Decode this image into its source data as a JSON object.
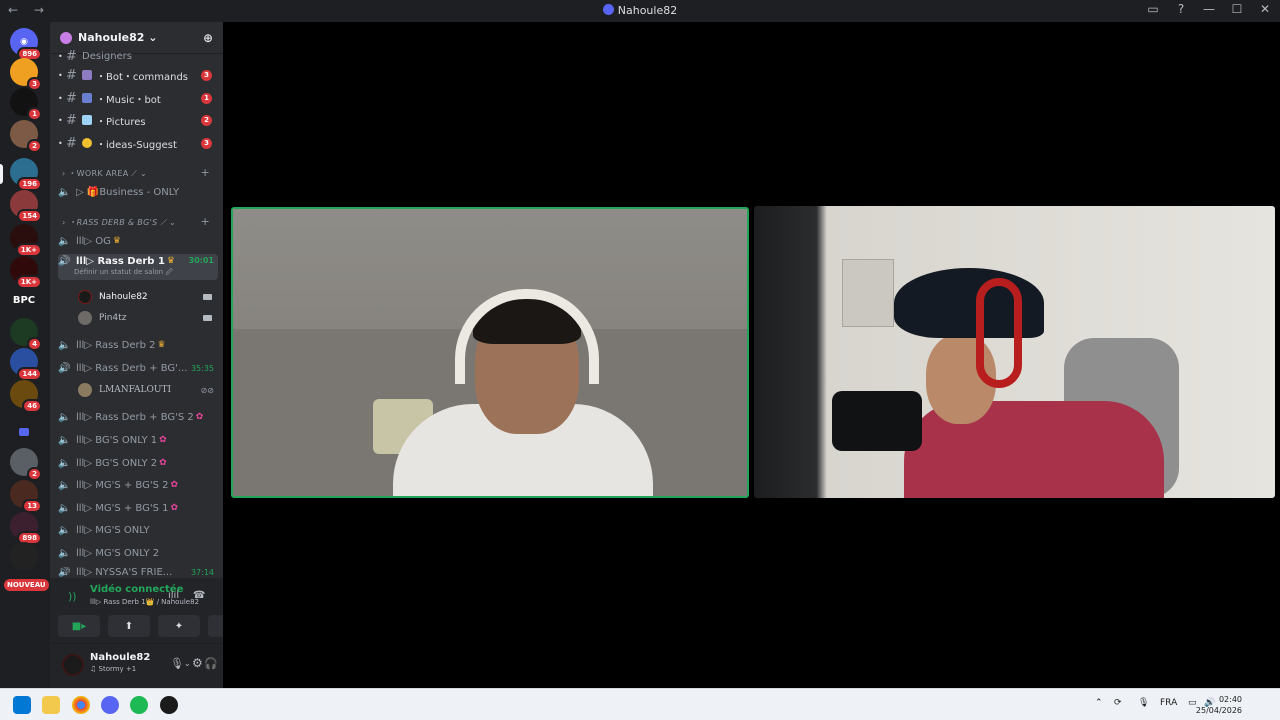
{
  "window": {
    "title": "Nahoule82",
    "nav": "← →",
    "controls": [
      "▭",
      "?",
      "—",
      "☐",
      "✕"
    ]
  },
  "guild": {
    "name": "Nahoule82 ⌄",
    "add_icon": "add-member-icon"
  },
  "servers": {
    "badges": [
      "896",
      "3",
      "1",
      "2",
      "196",
      "154",
      "1K+",
      "1K+",
      "4",
      "144",
      "46",
      "2",
      "13",
      "898"
    ],
    "bpc_label": "BPC",
    "nouveau_label": "NOUVEAU"
  },
  "text_channels": [
    {
      "name": "Designers",
      "count": ""
    },
    {
      "name": "・Bot・commands",
      "count": "3"
    },
    {
      "name": "・Music・bot",
      "count": "1"
    },
    {
      "name": "・Pictures",
      "count": "2"
    },
    {
      "name": "・ideas-Suggest",
      "count": "3"
    }
  ],
  "categories": {
    "work_area": "WORK AREA ⟋ ⌄",
    "rass_derb": "RASS DERB & BG'S ⟋ ⌄"
  },
  "voice_channels": {
    "business": "▷ 🎁Business - ONLY",
    "og": "lll▷ OG",
    "rass1": "lll▷ Rass Derb 1",
    "rass1_timer": "30:01",
    "rass1_status": "Définir un statut de salon 🖉",
    "rass2": "lll▷ Rass Derb 2",
    "rass_bg": "lll▷ Rass Derb + BG'...",
    "rass_bg_timer": "35:35",
    "rass_bg2": "lll▷ Rass Derb + BG'S 2",
    "bg1": "lll▷ BG'S ONLY 1",
    "bg2": "lll▷ BG'S ONLY 2",
    "mg_bg2": "lll▷ MG'S + BG'S 2",
    "mg_bg1": "lll▷ MG'S + BG'S 1",
    "mg": "lll▷ MG'S ONLY",
    "mg2": "lll▷ MG'S ONLY 2",
    "nyssa": "lll▷ NYSSA'S FRIE...",
    "nyssa_timer": "37:14"
  },
  "voice_users": [
    {
      "name": "Nahoule82",
      "channel": "rass1"
    },
    {
      "name": "Pin4tz",
      "channel": "rass1"
    },
    {
      "name": "LMANFALOUTI",
      "channel": "rass_bg"
    }
  ],
  "voice_panel": {
    "status": "Vidéo connectée",
    "location": "lll▷ Rass Derb 1👑 / Nahoule82"
  },
  "user_panel": {
    "name": "Nahoule82",
    "activity": "♫ Stormy +1"
  },
  "taskbar": {
    "language": "FRA",
    "time": "02:40",
    "date": "25/04/2026"
  },
  "colors": {
    "accent_green": "#23a55a",
    "badge_red": "#da373c",
    "sidebar_bg": "#2b2d31",
    "server_bg": "#1e1f22"
  }
}
